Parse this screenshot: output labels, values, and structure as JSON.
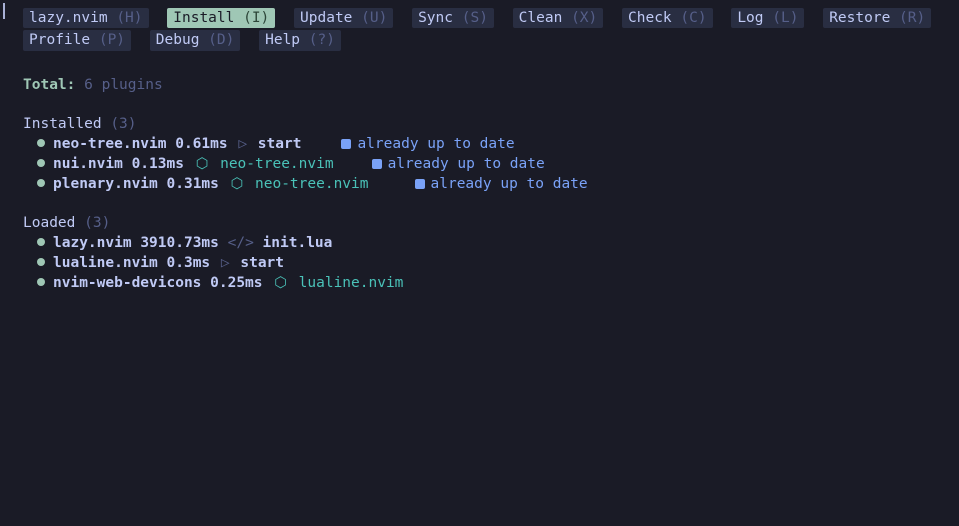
{
  "tabs": [
    {
      "label": "lazy.nvim",
      "key": "(H)",
      "active": false
    },
    {
      "label": "Install",
      "key": "(I)",
      "active": true
    },
    {
      "label": "Update",
      "key": "(U)",
      "active": false
    },
    {
      "label": "Sync",
      "key": "(S)",
      "active": false
    },
    {
      "label": "Clean",
      "key": "(X)",
      "active": false
    },
    {
      "label": "Check",
      "key": "(C)",
      "active": false
    },
    {
      "label": "Log",
      "key": "(L)",
      "active": false
    },
    {
      "label": "Restore",
      "key": "(R)",
      "active": false
    },
    {
      "label": "Profile",
      "key": "(P)",
      "active": false
    },
    {
      "label": "Debug",
      "key": "(D)",
      "active": false
    },
    {
      "label": "Help",
      "key": "(?)",
      "active": false
    }
  ],
  "total": {
    "label": "Total:",
    "value": "6 plugins"
  },
  "sections": {
    "installed": {
      "heading": "Installed",
      "count": "(3)",
      "items": [
        {
          "name": "neo-tree.nvim",
          "time": "0.61ms",
          "reason_type": "start",
          "reason": "start",
          "gap": "gap-sm",
          "status": "already up to date"
        },
        {
          "name": "nui.nvim",
          "time": "0.13ms",
          "reason_type": "pkg",
          "reason": "neo-tree.nvim",
          "gap": "gap-md",
          "status": "already up to date"
        },
        {
          "name": "plenary.nvim",
          "time": "0.31ms",
          "reason_type": "pkg",
          "reason": "neo-tree.nvim",
          "gap": "gap-lg",
          "status": "already up to date"
        }
      ]
    },
    "loaded": {
      "heading": "Loaded",
      "count": "(3)",
      "items": [
        {
          "name": "lazy.nvim",
          "time": "3910.73ms",
          "reason_type": "code",
          "reason": "init.lua"
        },
        {
          "name": "lualine.nvim",
          "time": "0.3ms",
          "reason_type": "start",
          "reason": "start"
        },
        {
          "name": "nvim-web-devicons",
          "time": "0.25ms",
          "reason_type": "pkg",
          "reason": "lualine.nvim"
        }
      ]
    }
  }
}
